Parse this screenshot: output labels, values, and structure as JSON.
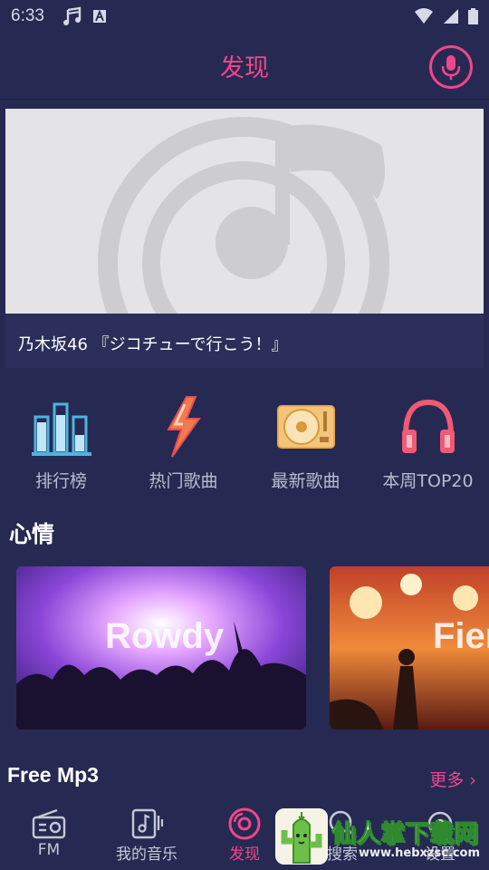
{
  "status": {
    "time": "6:33"
  },
  "header": {
    "title": "发现"
  },
  "banner": {
    "caption": "乃木坂46 『ジコチューで行こう！』"
  },
  "categories": [
    {
      "label": "排行榜",
      "icon": "chart-bars-icon"
    },
    {
      "label": "热门歌曲",
      "icon": "lightning-icon"
    },
    {
      "label": "最新歌曲",
      "icon": "turntable-icon"
    },
    {
      "label": "本周TOP20",
      "icon": "headphones-icon"
    }
  ],
  "mood": {
    "title": "心情",
    "cards": [
      {
        "label": "Rowdy"
      },
      {
        "label": "Fiery"
      }
    ]
  },
  "free_mp3": {
    "title": "Free Mp3",
    "more": "更多"
  },
  "tabs": [
    {
      "label": "FM",
      "icon": "radio-icon"
    },
    {
      "label": "我的音乐",
      "icon": "music-note-icon"
    },
    {
      "label": "发现",
      "icon": "disc-icon"
    },
    {
      "label": "搜索",
      "icon": "search-icon"
    },
    {
      "label": "设置",
      "icon": "gear-icon"
    }
  ],
  "watermark": {
    "text": "仙人掌下载网",
    "url": "www.hebxzsc.com"
  },
  "colors": {
    "background": "#262a52",
    "accent": "#f0468a"
  }
}
